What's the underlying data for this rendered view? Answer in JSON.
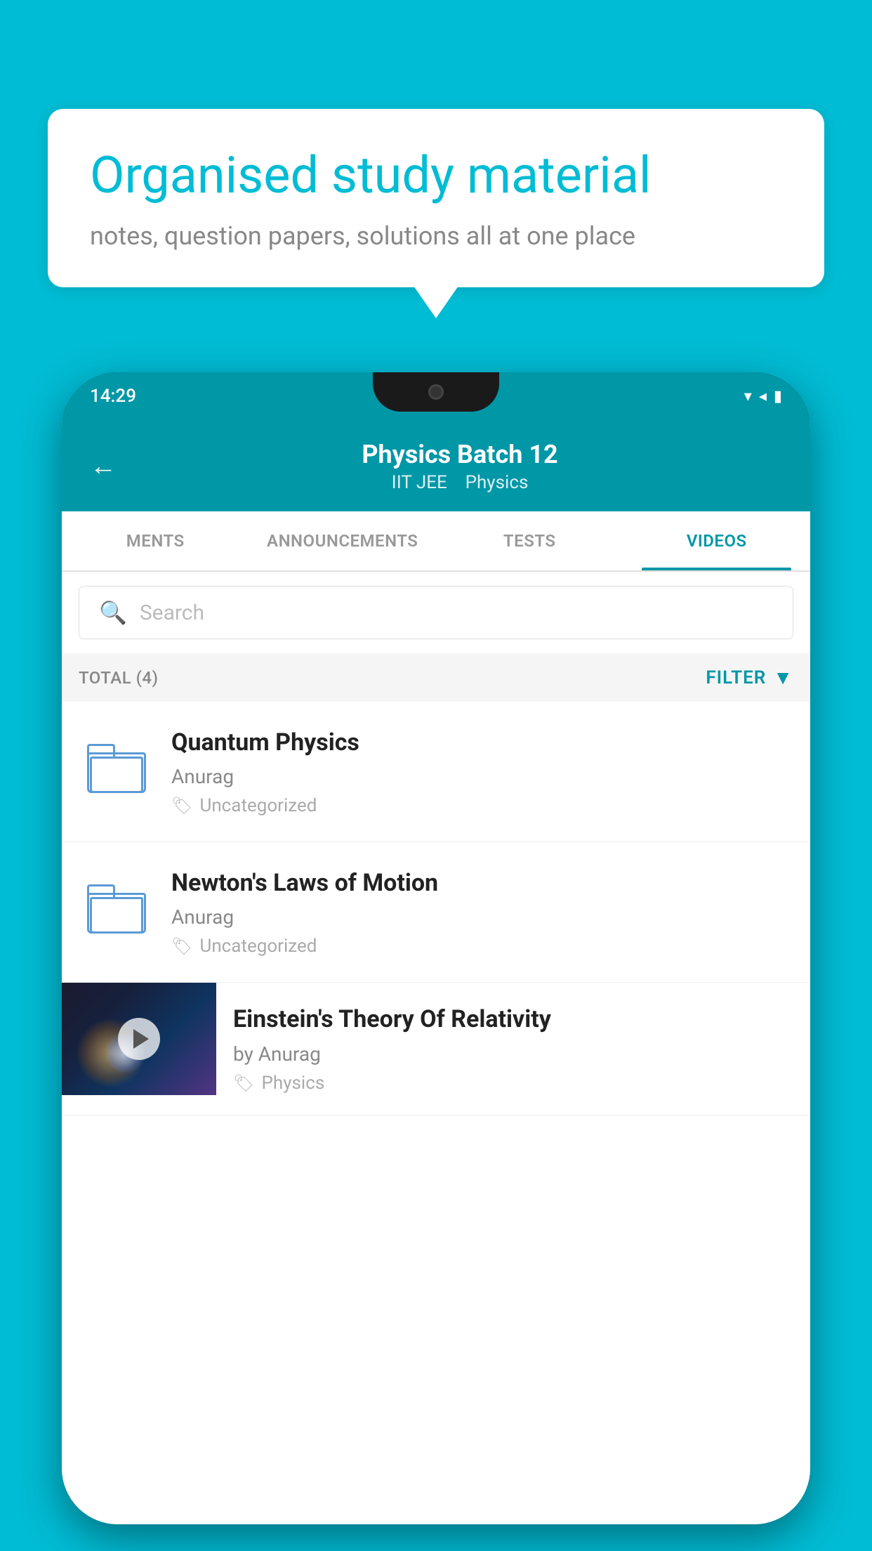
{
  "bubble": {
    "headline": "Organised study material",
    "subtext": "notes, question papers, solutions all at one place"
  },
  "phone": {
    "status": {
      "time": "14:29",
      "icons": "▾◂▮"
    },
    "header": {
      "title": "Physics Batch 12",
      "subtitle_part1": "IIT JEE",
      "subtitle_part2": "Physics",
      "back_label": "←"
    },
    "tabs": [
      {
        "label": "MENTS",
        "active": false
      },
      {
        "label": "ANNOUNCEMENTS",
        "active": false
      },
      {
        "label": "TESTS",
        "active": false
      },
      {
        "label": "VIDEOS",
        "active": true
      }
    ],
    "search": {
      "placeholder": "Search"
    },
    "filter_row": {
      "total_label": "TOTAL (4)",
      "filter_label": "FILTER"
    },
    "videos": [
      {
        "id": "quantum",
        "title": "Quantum Physics",
        "author": "Anurag",
        "tag": "Uncategorized",
        "has_thumb": false
      },
      {
        "id": "newton",
        "title": "Newton's Laws of Motion",
        "author": "Anurag",
        "tag": "Uncategorized",
        "has_thumb": false
      },
      {
        "id": "einstein",
        "title": "Einstein's Theory Of Relativity",
        "author": "by Anurag",
        "tag": "Physics",
        "has_thumb": true
      }
    ]
  }
}
